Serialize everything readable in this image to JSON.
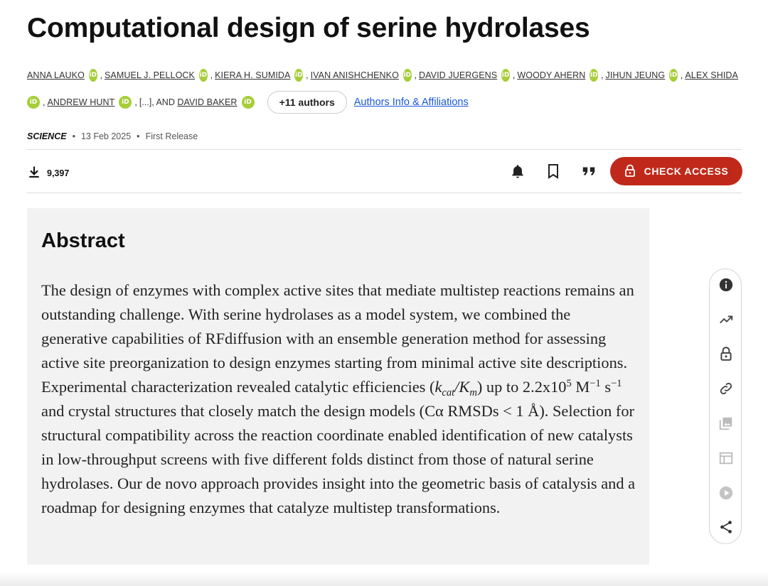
{
  "article": {
    "title": "Computational design of serine hydrolases"
  },
  "authors": {
    "line1": [
      "ANNA LAUKO",
      "SAMUEL J. PELLOCK",
      "KIERA H. SUMIDA",
      "IVAN ANISHCHENKO",
      "DAVID JUERGENS",
      "WOODY AHERN",
      "JIHUN JEUNG",
      "ALEX SHIDA"
    ],
    "line2_first": "ANDREW HUNT",
    "ellipsis": "[...], AND",
    "last": "DAVID BAKER",
    "separator": ",",
    "orcid_label": "iD",
    "more_button": "+11 authors",
    "affiliations_link": "Authors Info & Affiliations"
  },
  "meta": {
    "journal": "SCIENCE",
    "date": "13 Feb 2025",
    "status": "First Release",
    "bullet": "•"
  },
  "toolbar": {
    "downloads": "9,397",
    "check_access": "CHECK ACCESS",
    "icons": [
      "download-icon",
      "bell-icon",
      "bookmark-icon",
      "quote-icon",
      "lock-icon"
    ]
  },
  "abstract": {
    "heading": "Abstract",
    "p1": "The design of enzymes with complex active sites that mediate multistep reactions remains an outstanding challenge. With serine hydrolases as a model system, we combined the generative capabilities of RFdiffusion with an ensemble generation method for assessing active site preorganization to design enzymes starting from minimal active site descriptions. Experimental characterization revealed catalytic efficiencies (",
    "k": "k",
    "k_sub": "cat",
    "slash": "/",
    "K": "K",
    "K_sub": "m",
    "p2": ") up to 2.2x10",
    "exp1": "5",
    "p3": " M",
    "exp2": "−1",
    "p4": " s",
    "exp3": "−1",
    "p5": " and crystal structures that closely match the design models (Cα RMSDs < 1 Å). Selection for structural compatibility across the reaction coordinate enabled identification of new catalysts in low-throughput screens with five different folds distinct from those of natural serine hydrolases. Our de novo approach provides insight into the geometric basis of catalysis and a roadmap for designing enzymes that catalyze multistep transformations."
  },
  "side_rail": {
    "icons": [
      "info-icon",
      "trending-icon",
      "lock-open-icon",
      "link-icon",
      "images-icon",
      "table-icon",
      "play-icon",
      "share-icon"
    ]
  },
  "colors": {
    "accent_red": "#c0291a",
    "orcid_green": "#a6ce39",
    "link_blue": "#1a58d6",
    "abstract_bg": "#f2f2f2"
  }
}
